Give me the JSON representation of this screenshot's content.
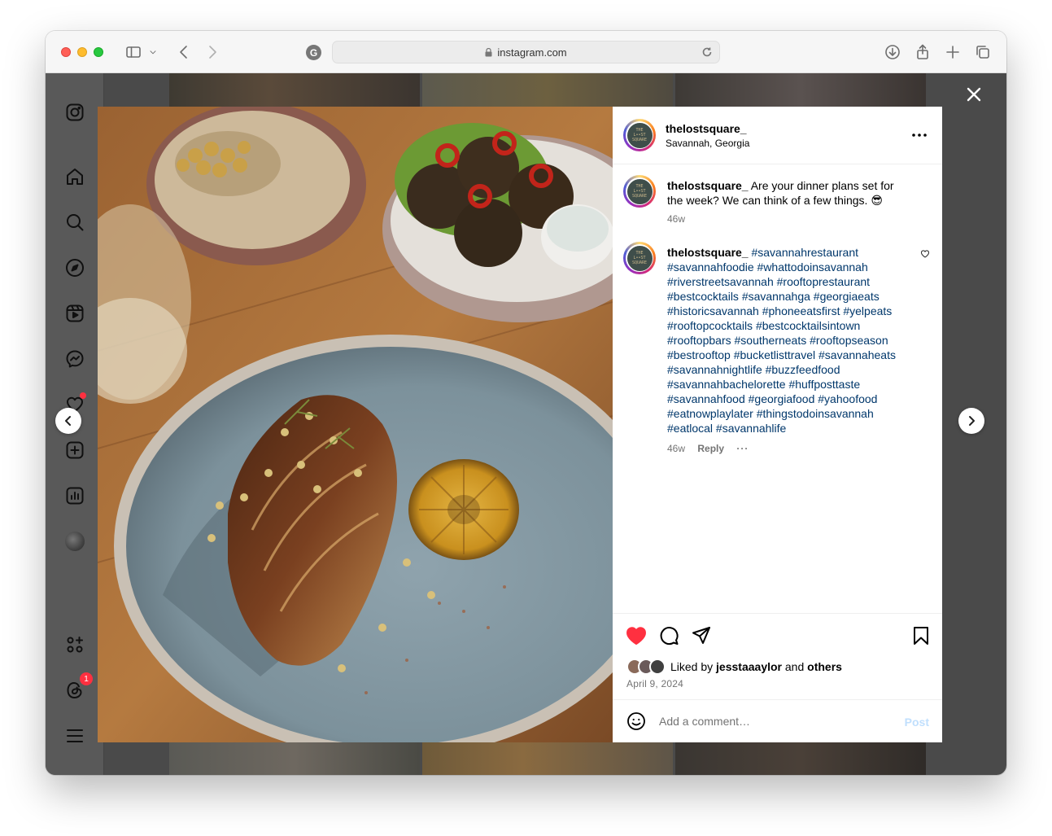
{
  "browser": {
    "url": "instagram.com"
  },
  "post": {
    "username": "thelostsquare_",
    "location": "Savannah, Georgia",
    "avatar_text": [
      "THE",
      "L••ST",
      "SQUARE"
    ],
    "caption": {
      "username": "thelostsquare_",
      "text": "Are your dinner plans set for the week? We can think of a few things. 😎",
      "age": "46w"
    },
    "comment": {
      "username": "thelostsquare_",
      "hashtags": "#savannahrestaurant #savannahfoodie #whattodoinsavannah #riverstreetsavannah #rooftoprestaurant #bestcocktails #savannahga #georgiaeats #historicsavannah #phoneeatsfirst #yelpeats #rooftopcocktails #bestcocktailsintown #rooftopbars #southerneats #rooftopseason #bestrooftop #bucketlisttravel #savannaheats #savannahnightlife #buzzfeedfood #savannahbachelorette #huffposttaste #savannahfood #georgiafood #yahoofood #eatnowplaylater #thingstodoinsavannah #eatlocal #savannahlife",
      "age": "46w",
      "reply_label": "Reply"
    },
    "likes": {
      "prefix": "Liked by",
      "user": "jesstaaaylor",
      "middle": "and",
      "suffix": "others"
    },
    "date": "April 9, 2024",
    "add_comment_placeholder": "Add a comment…",
    "post_label": "Post"
  },
  "sidebar": {
    "notification_count": "1"
  },
  "colors": {
    "like_red": "#ff3040",
    "hashtag_blue": "#00376b",
    "post_disabled": "#c0dffd"
  },
  "icons": [
    "instagram-icon",
    "home-icon",
    "search-icon",
    "explore-icon",
    "reels-icon",
    "messenger-icon",
    "notifications-icon",
    "create-icon",
    "dashboard-icon",
    "profile-avatar",
    "also-from-meta-icon",
    "threads-icon",
    "menu-icon"
  ]
}
